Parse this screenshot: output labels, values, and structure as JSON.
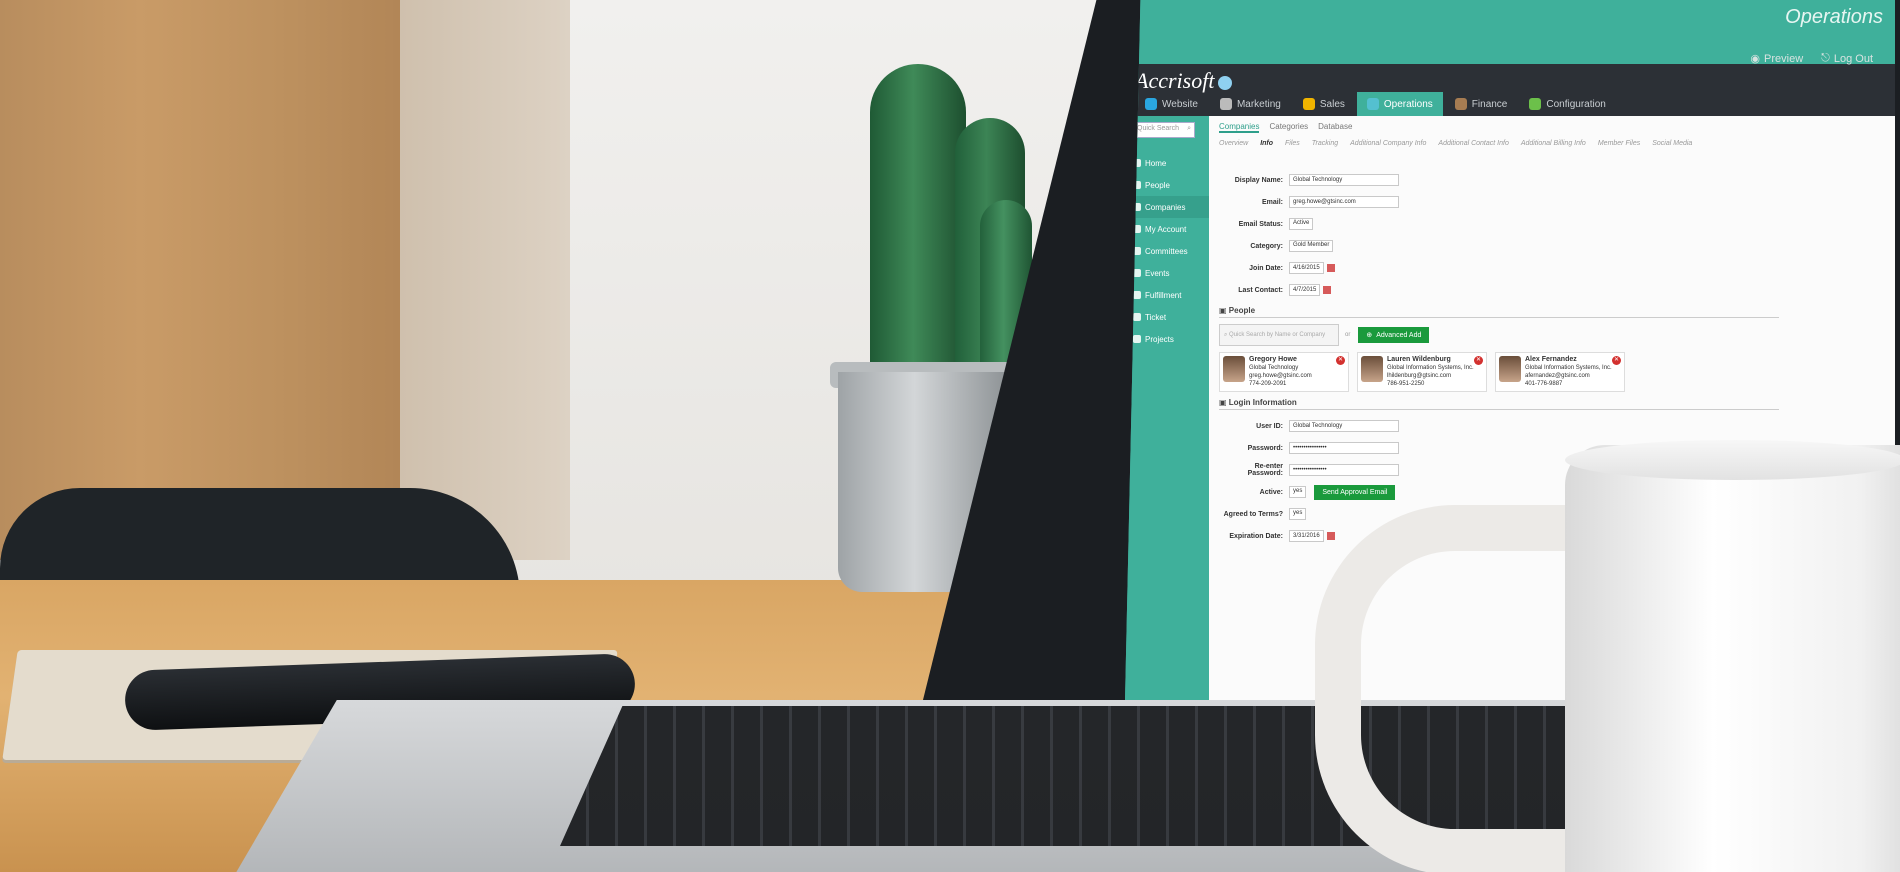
{
  "app": {
    "title": "Operations",
    "logo": "Accrisoft",
    "preview": "Preview",
    "logout": "Log Out"
  },
  "modules": [
    {
      "label": "Website",
      "color": "#2aa6e0"
    },
    {
      "label": "Marketing",
      "color": "#bbbbbb"
    },
    {
      "label": "Sales",
      "color": "#f0b400"
    },
    {
      "label": "Operations",
      "color": "#54c0d0"
    },
    {
      "label": "Finance",
      "color": "#a67c52"
    },
    {
      "label": "Configuration",
      "color": "#6cc04a"
    }
  ],
  "sidebar": {
    "search_placeholder": "Quick Search",
    "items": [
      "Home",
      "People",
      "Companies",
      "My Account",
      "Committees",
      "Events",
      "Fulfillment",
      "Ticket",
      "Projects"
    ]
  },
  "tabs": [
    "Companies",
    "Categories",
    "Database"
  ],
  "subtabs": [
    "Overview",
    "Info",
    "Files",
    "Tracking",
    "Additional Company Info",
    "Additional Contact Info",
    "Additional Billing Info",
    "Member Files",
    "Social Media"
  ],
  "form": {
    "display_name_label": "Display Name:",
    "display_name": "Global Technology",
    "email_label": "Email:",
    "email": "greg.howe@gtsinc.com",
    "email_status_label": "Email Status:",
    "email_status": "Active",
    "category_label": "Category:",
    "category": "Gold Member",
    "join_date_label": "Join Date:",
    "join_date": "4/16/2015",
    "last_contact_label": "Last Contact:",
    "last_contact": "4/7/2015"
  },
  "people": {
    "section": "People",
    "search_placeholder": "Quick Search by Name or Company",
    "or": "or",
    "advanced_add": "Advanced Add",
    "list": [
      {
        "name": "Gregory Howe",
        "company": "Global Technology",
        "email": "greg.howe@gtsinc.com",
        "phone": "774-209-2091"
      },
      {
        "name": "Lauren Wildenburg",
        "company": "Global Information Systems, Inc.",
        "email": "lhildenburg@gtsinc.com",
        "phone": "786-951-2250"
      },
      {
        "name": "Alex Fernandez",
        "company": "Global Information Systems, Inc.",
        "email": "afernandez@gtsinc.com",
        "phone": "401-776-9887"
      }
    ]
  },
  "login": {
    "section": "Login Information",
    "userid_label": "User ID:",
    "userid": "Global Technology",
    "password_label": "Password:",
    "password": "••••••••••••••••",
    "reenter_label": "Re-enter Password:",
    "reenter": "••••••••••••••••",
    "active_label": "Active:",
    "active": "yes",
    "send_approval": "Send Approval Email",
    "agreed_label": "Agreed to Terms?",
    "agreed": "yes",
    "expiration_label": "Expiration Date:",
    "expiration": "3/31/2016"
  }
}
